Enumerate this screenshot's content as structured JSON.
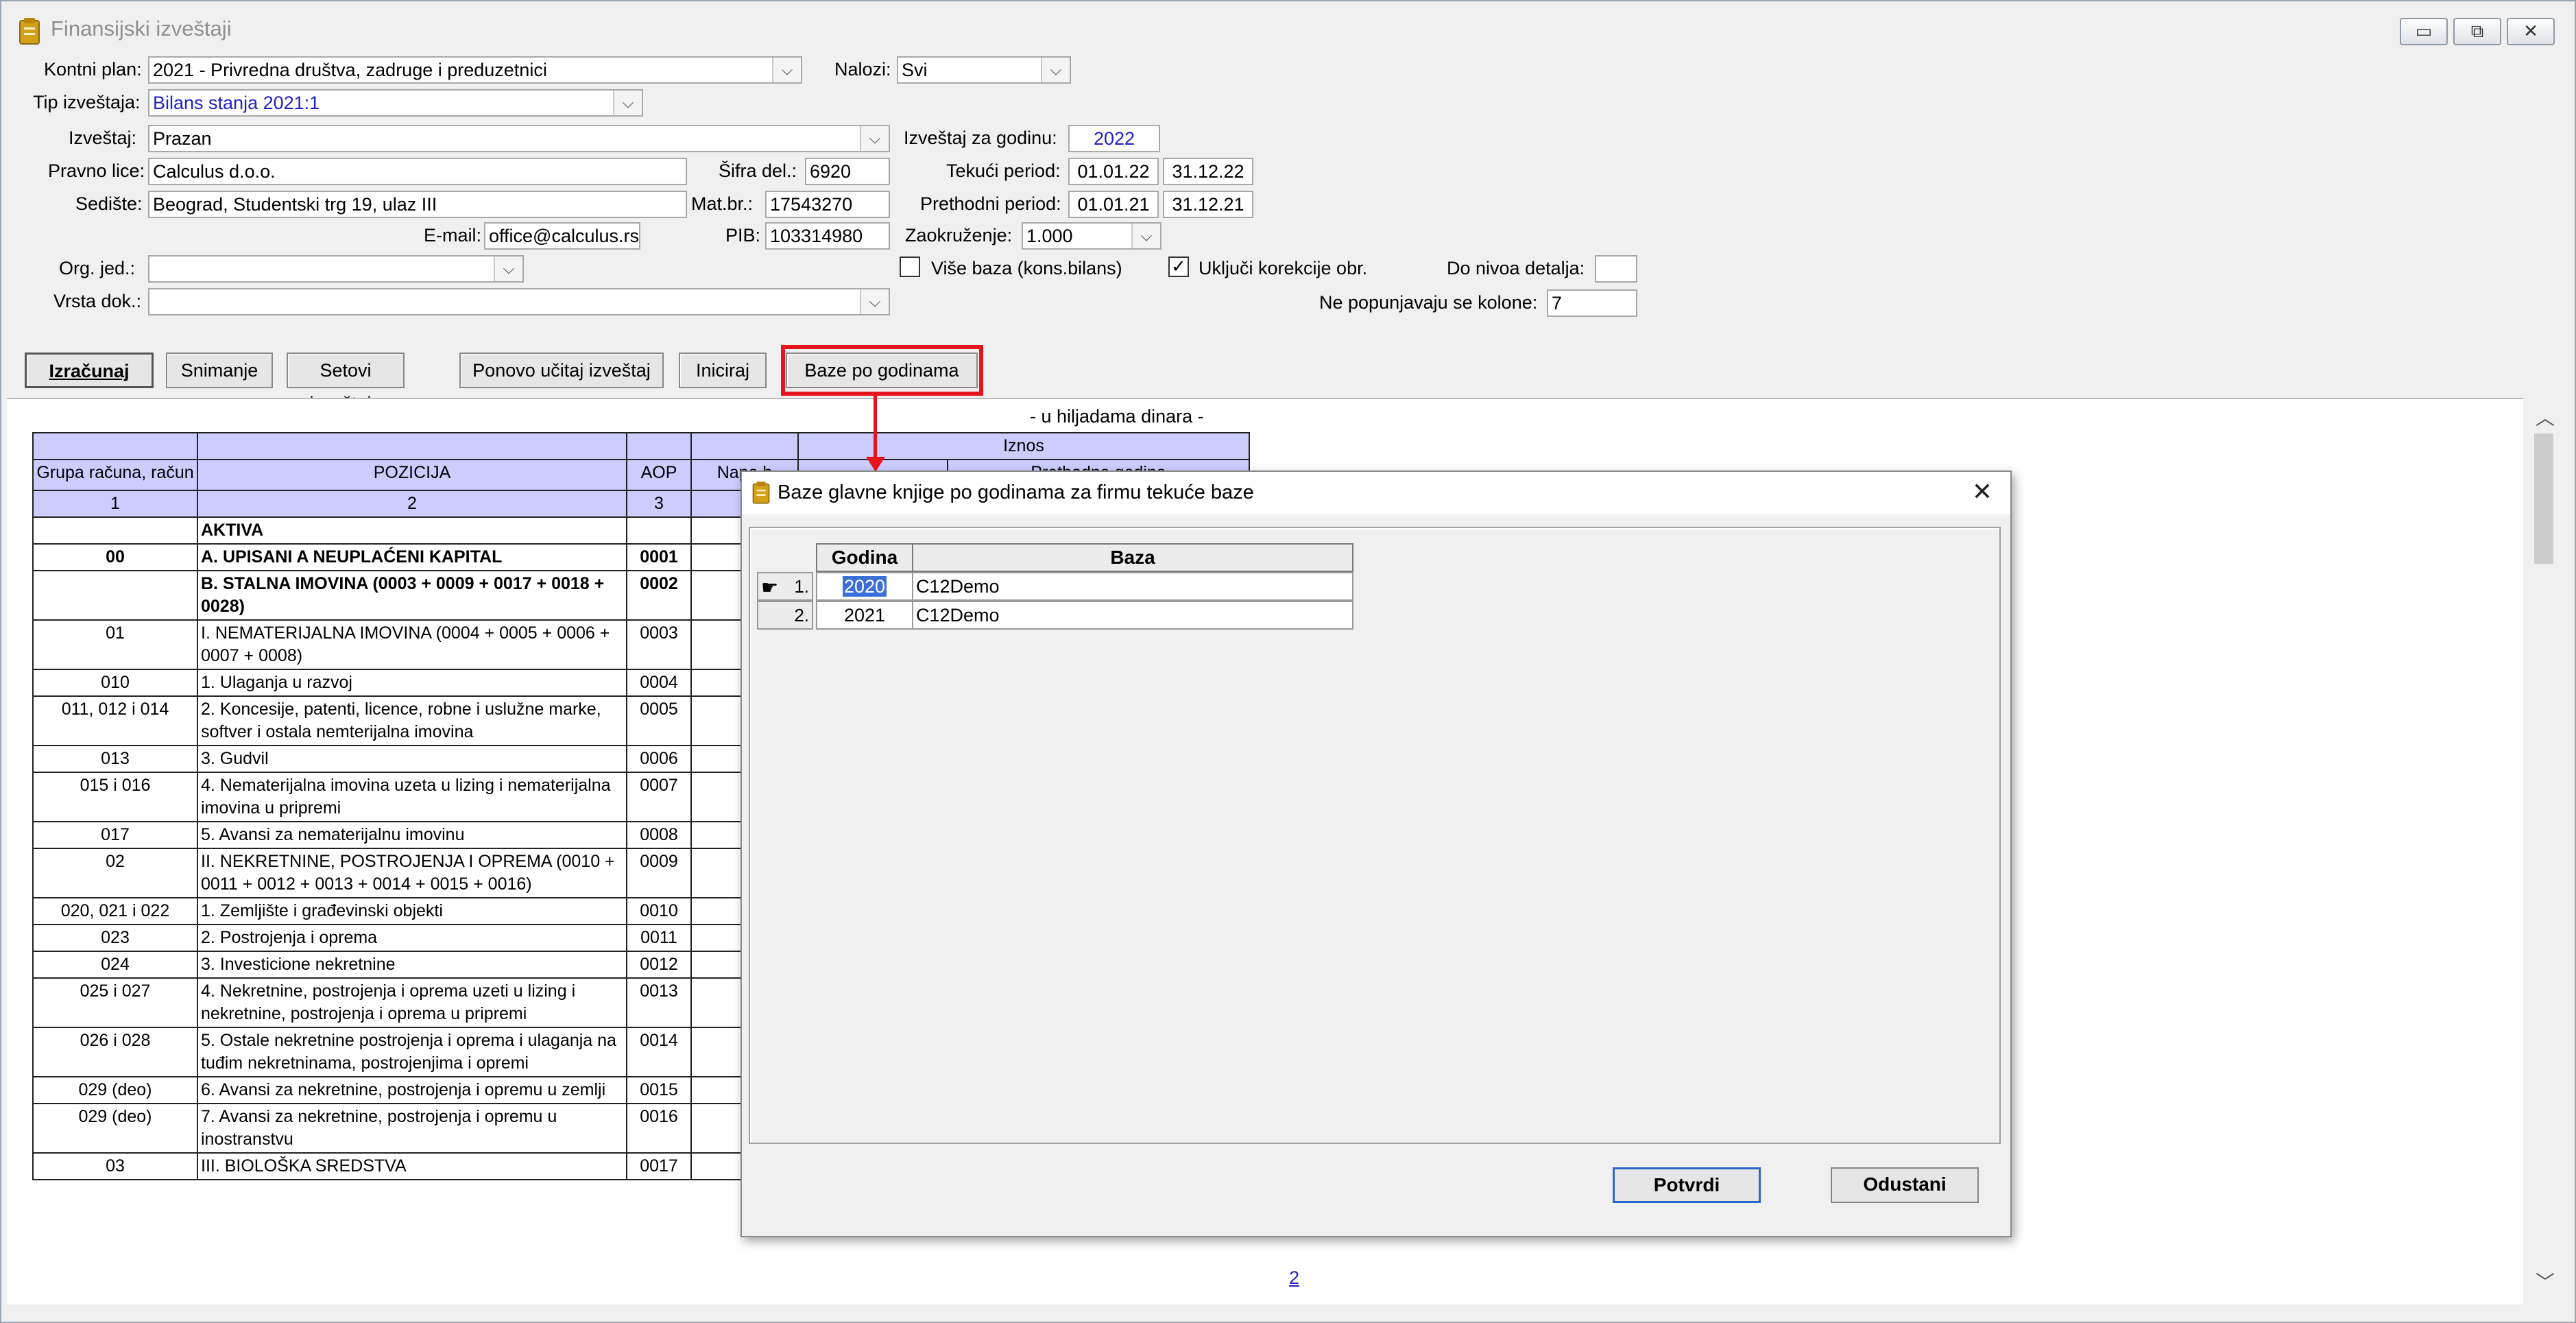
{
  "window": {
    "title": "Finansijski izveštaji",
    "minimize": "▭",
    "restore": "⧉",
    "close": "✕"
  },
  "form": {
    "kontni_plan_label": "Kontni plan:",
    "kontni_plan_value": "2021 - Privredna društva, zadruge i preduzetnici",
    "nalozi_label": "Nalozi:",
    "nalozi_value": "Svi",
    "tip_label": "Tip izveštaja:",
    "tip_value": "Bilans stanja 2021:1",
    "izvestaj_label": "Izveštaj:",
    "izvestaj_value": "Prazan",
    "pravno_lice_label": "Pravno lice:",
    "pravno_lice_value": "Calculus d.o.o.",
    "sediste_label": "Sedište:",
    "sediste_value": "Beograd, Studentski trg 19, ulaz III",
    "email_label": "E-mail:",
    "email_value": "office@calculus.rs",
    "sifra_label": "Šifra del.:",
    "sifra_value": "6920",
    "matbr_label": "Mat.br.:",
    "matbr_value": "17543270",
    "pib_label": "PIB:",
    "pib_value": "103314980",
    "godina_label": "Izveštaj za godinu:",
    "godina_value": "2022",
    "tekuci_label": "Tekući period:",
    "tekuci_od": "01.01.22",
    "tekuci_do": "31.12.22",
    "prethodni_label": "Prethodni period:",
    "prethodni_od": "01.01.21",
    "prethodni_do": "31.12.21",
    "zaokr_label": "Zaokruženje:",
    "zaokr_value": "1.000",
    "org_label": "Org. jed.:",
    "org_value": "",
    "vrsta_label": "Vrsta dok.:",
    "vrsta_value": "",
    "vise_baza_label": "Više baza (kons.bilans)",
    "vise_baza_checked": false,
    "ukljuci_label": "Uključi korekcije obr.",
    "ukljuci_checked": true,
    "ukljuci_mark": "✓",
    "nivo_label": "Do nivoa detalja:",
    "nivo_value": "",
    "ne_popunjavaju_label": "Ne popunjavaju se kolone:",
    "ne_popunjavaju_value": "7",
    "dropdown_arrow": "⌵"
  },
  "toolbar": {
    "izracunaj": "Izračunaj",
    "snimanje": "Snimanje",
    "setovi": "Setovi izveštaja",
    "ponovo": "Ponovo učitaj izveštaj",
    "iniciraj": "Iniciraj",
    "baze": "Baze po godinama"
  },
  "report": {
    "unit_note": "- u hiljadama dinara -",
    "header_iznos": "Iznos",
    "header_prethodna": "Prethodna godina",
    "col_grupa": "Grupa računa, račun",
    "col_pozicija": "POZICIJA",
    "col_aop": "AOP",
    "col_napomena": "Napo b",
    "num_1": "1",
    "num_2": "2",
    "num_3": "3",
    "rows": [
      {
        "grupa": "",
        "pozicija": "AKTIVA",
        "aop": "",
        "bold": true
      },
      {
        "grupa": "00",
        "pozicija": "A. UPISANI A NEUPLAĆENI KAPITAL",
        "aop": "0001",
        "bold": true
      },
      {
        "grupa": "",
        "pozicija": "B. STALNA IMOVINA (0003 + 0009 + 0017 + 0018 + 0028)",
        "aop": "0002",
        "bold": true
      },
      {
        "grupa": "01",
        "pozicija": "I. NEMATERIJALNA IMOVINA (0004 + 0005 + 0006 + 0007 + 0008)",
        "aop": "0003",
        "bold": false
      },
      {
        "grupa": "010",
        "pozicija": "1. Ulaganja u razvoj",
        "aop": "0004",
        "bold": false
      },
      {
        "grupa": "011, 012 i 014",
        "pozicija": "2. Koncesije, patenti, licence, robne i uslužne marke, softver i ostala nemterijalna imovina",
        "aop": "0005",
        "bold": false
      },
      {
        "grupa": "013",
        "pozicija": "3. Gudvil",
        "aop": "0006",
        "bold": false
      },
      {
        "grupa": "015 i 016",
        "pozicija": "4. Nematerijalna imovina uzeta u lizing i nematerijalna imovina u pripremi",
        "aop": "0007",
        "bold": false
      },
      {
        "grupa": "017",
        "pozicija": "5. Avansi za nematerijalnu imovinu",
        "aop": "0008",
        "bold": false
      },
      {
        "grupa": "02",
        "pozicija": "II. NEKRETNINE, POSTROJENJA I OPREMA (0010 + 0011 + 0012 + 0013 + 0014 + 0015 + 0016)",
        "aop": "0009",
        "bold": false
      },
      {
        "grupa": "020, 021 i 022",
        "pozicija": "1. Zemljište i građevinski objekti",
        "aop": "0010",
        "bold": false
      },
      {
        "grupa": "023",
        "pozicija": "2. Postrojenja i oprema",
        "aop": "0011",
        "bold": false
      },
      {
        "grupa": "024",
        "pozicija": "3. Investicione nekretnine",
        "aop": "0012",
        "bold": false
      },
      {
        "grupa": "025 i 027",
        "pozicija": "4. Nekretnine, postrojenja i oprema uzeti u lizing i nekretnine, postrojenja i oprema u pripremi",
        "aop": "0013",
        "bold": false
      },
      {
        "grupa": "026 i 028",
        "pozicija": "5. Ostale nekretnine postrojenja i oprema i ulaganja na tuđim nekretninama, postrojenjima i opremi",
        "aop": "0014",
        "bold": false
      },
      {
        "grupa": "029 (deo)",
        "pozicija": "6. Avansi za nekretnine, postrojenja i opremu u zemlji",
        "aop": "0015",
        "bold": false
      },
      {
        "grupa": "029 (deo)",
        "pozicija": "7. Avansi za nekretnine, postrojenja i opremu u inostranstvu",
        "aop": "0016",
        "bold": false
      },
      {
        "grupa": "03",
        "pozicija": "III. BIOLOŠKA SREDSTVA",
        "aop": "0017",
        "bold": false
      }
    ],
    "page_link": "2"
  },
  "dialog": {
    "title": "Baze glavne knjige po godinama za firmu tekuće baze",
    "close": "✕",
    "col_godina": "Godina",
    "col_baza": "Baza",
    "rows": [
      {
        "idx": "1.",
        "godina": "2020",
        "baza": "C12Demo",
        "selected": true
      },
      {
        "idx": "2.",
        "godina": "2021",
        "baza": "C12Demo",
        "selected": false
      }
    ],
    "potvrdi": "Potvrdi",
    "odustani": "Odustani"
  }
}
